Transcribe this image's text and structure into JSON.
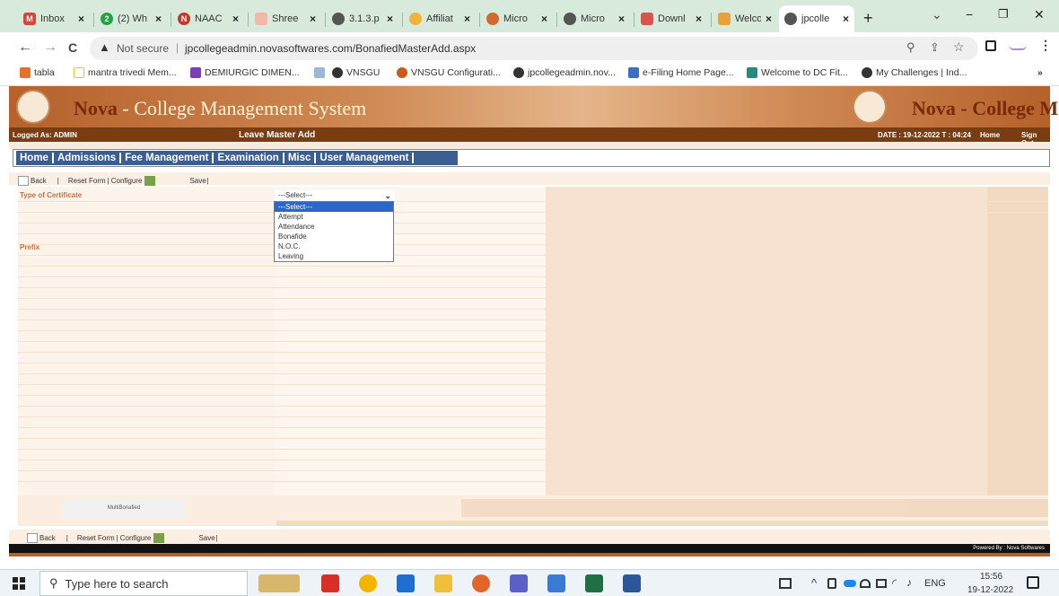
{
  "browser": {
    "tabs": [
      {
        "title": "Inbox",
        "icon": "gmail-icon"
      },
      {
        "title": "(2) Wh",
        "icon": "whatsapp-icon"
      },
      {
        "title": "NAAC",
        "icon": "naac-icon"
      },
      {
        "title": "Shree",
        "icon": "shree-icon"
      },
      {
        "title": "3.1.3.p",
        "icon": "globe-icon"
      },
      {
        "title": "Affiliat",
        "icon": "affiliate-icon"
      },
      {
        "title": "Micro",
        "icon": "micro-icon"
      },
      {
        "title": "Micro",
        "icon": "globe-icon"
      },
      {
        "title": "Downl",
        "icon": "download-icon"
      },
      {
        "title": "Welco",
        "icon": "welcome-icon"
      },
      {
        "title": "jpcolle",
        "icon": "globe-icon"
      }
    ],
    "new_tab": "+",
    "close_x": "×",
    "window_controls": {
      "chevron": "⌄",
      "minimize": "−",
      "restore": "❐",
      "close": "✕"
    },
    "nav": {
      "back": "←",
      "forward": "→",
      "reload": "C",
      "not_secure": "Not secure",
      "separator": "|",
      "url": "jpcollegeadmin.novasoftwares.com/BonafiedMasterAdd.aspx"
    },
    "bookmarks": [
      {
        "label": "tabla",
        "color": "#e8702a"
      },
      {
        "label": "mantra trivedi Mem...",
        "color": "#f3c233"
      },
      {
        "label": "DEMIURGIC DIMEN...",
        "color": "#7b3fb8"
      },
      {
        "label": "",
        "color": "#9bb8d8"
      },
      {
        "label": "VNSGU",
        "color": "#333333"
      },
      {
        "label": "VNSGU Configurati...",
        "color": "#c85a1e"
      },
      {
        "label": "jpcollegeadmin.nov...",
        "color": "#333333"
      },
      {
        "label": "e-Filing Home Page...",
        "color": "#3a6fc4"
      },
      {
        "label": "Welcome to DC Fit...",
        "color": "#2a8a7a"
      },
      {
        "label": "My Challenges | Ind...",
        "color": "#333333"
      }
    ],
    "bookmarks_more": "»"
  },
  "app": {
    "logo_text": "Nova",
    "logo_sep": " - ",
    "logo_rest": "College Management System",
    "logo_text_right": "Nova",
    "logo_rest_right": "- College M",
    "logged_as": "Logged As: ADMIN",
    "page_title": "Leave Master Add",
    "date": "DATE : 19-12-2022 T : 04:24",
    "home": "Home",
    "sign_out": "Sign Out",
    "menu": [
      "Home",
      "Admissions",
      "Fee Management",
      "Examination",
      "Misc",
      "User Management"
    ],
    "toolbar": {
      "back": "Back",
      "reset": "Reset Form",
      "pipe": "|",
      "configure": "Configure",
      "save": "Save"
    },
    "fields": {
      "type_label": "Type of Certificate",
      "prefix_label": "Prefix",
      "multi": "MultiBonafied"
    },
    "dropdown": {
      "selected": "---Select---",
      "options": [
        "---Select---",
        "Attempt",
        "Attendance",
        "Bonafide",
        "N.O.C.",
        "Leaving"
      ]
    },
    "footer": "Powered By : Nova Softwares"
  },
  "taskbar": {
    "search_placeholder": "Type here to search",
    "lang": "ENG",
    "time": "15:56",
    "date": "19-12-2022",
    "tray": "^"
  }
}
